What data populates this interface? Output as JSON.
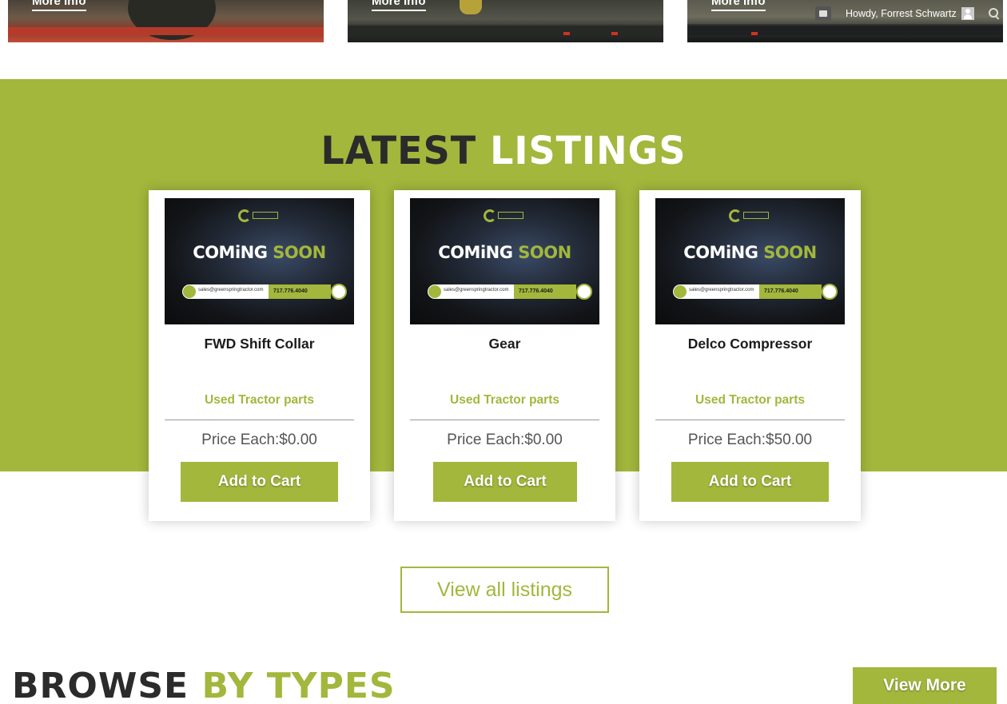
{
  "top_cards": [
    {
      "more_info": "More Info"
    },
    {
      "more_info": "More Info"
    },
    {
      "more_info": "More Info"
    }
  ],
  "admin_bar": {
    "greeting": "Howdy, Forrest Schwartz"
  },
  "latest": {
    "title_dark": "LATEST",
    "title_light": "LISTINGS",
    "listings": [
      {
        "name": "FWD Shift Collar",
        "category": "Used Tractor parts",
        "price": "Price Each:$0.00",
        "button": "Add to Cart"
      },
      {
        "name": "Gear",
        "category": "Used Tractor parts",
        "price": "Price Each:$0.00",
        "button": "Add to Cart"
      },
      {
        "name": "Delco Compressor",
        "category": "Used Tractor parts",
        "price": "Price Each:$50.00",
        "button": "Add to Cart"
      }
    ],
    "thumbnail": {
      "text_white": "COMiNG",
      "text_green": "SOON",
      "email": "sales@greenspringtractor.com",
      "phone": "717.776.4040"
    },
    "view_all": "View all listings"
  },
  "browse": {
    "title_dark": "BROWSE",
    "title_green": "BY TYPES",
    "view_more": "View More"
  },
  "colors": {
    "accent": "#a2b73c",
    "dark_text": "#2b2b2b"
  }
}
